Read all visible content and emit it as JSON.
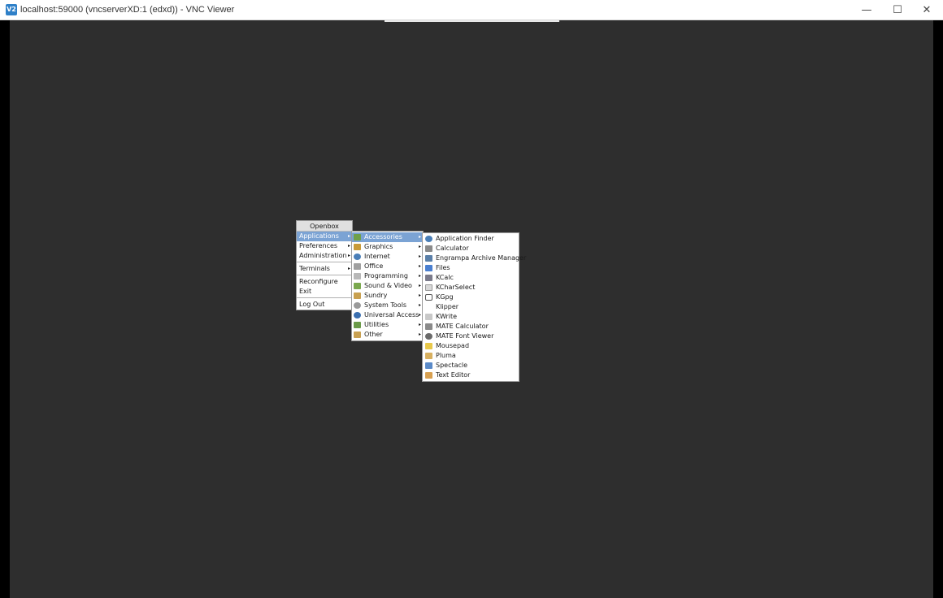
{
  "window": {
    "icon_label": "V2",
    "title": "localhost:59000 (vncserverXD:1 (edxd)) - VNC Viewer",
    "controls": {
      "minimize": "—",
      "maximize": "☐",
      "close": "✕"
    }
  },
  "root_menu": {
    "title": "Openbox",
    "items": [
      "Applications",
      "Preferences",
      "Administration",
      "Terminals",
      "Reconfigure",
      "Exit",
      "Log Out"
    ],
    "arrow": "▸"
  },
  "apps_menu": {
    "items": [
      "Accessories",
      "Graphics",
      "Internet",
      "Office",
      "Programming",
      "Sound & Video",
      "Sundry",
      "System Tools",
      "Universal Access",
      "Utilities",
      "Other"
    ]
  },
  "accessories_menu": {
    "items": [
      "Application Finder",
      "Calculator",
      "Engrampa Archive Manager",
      "Files",
      "KCalc",
      "KCharSelect",
      "KGpg",
      "Klipper",
      "KWrite",
      "MATE Calculator",
      "MATE Font Viewer",
      "Mousepad",
      "Pluma",
      "Spectacle",
      "Text Editor"
    ]
  },
  "colors": {
    "desktop_bg": "#2e2e2e",
    "menu_highlight": "#7ba3d4",
    "menu_bg": "#ffffff"
  }
}
